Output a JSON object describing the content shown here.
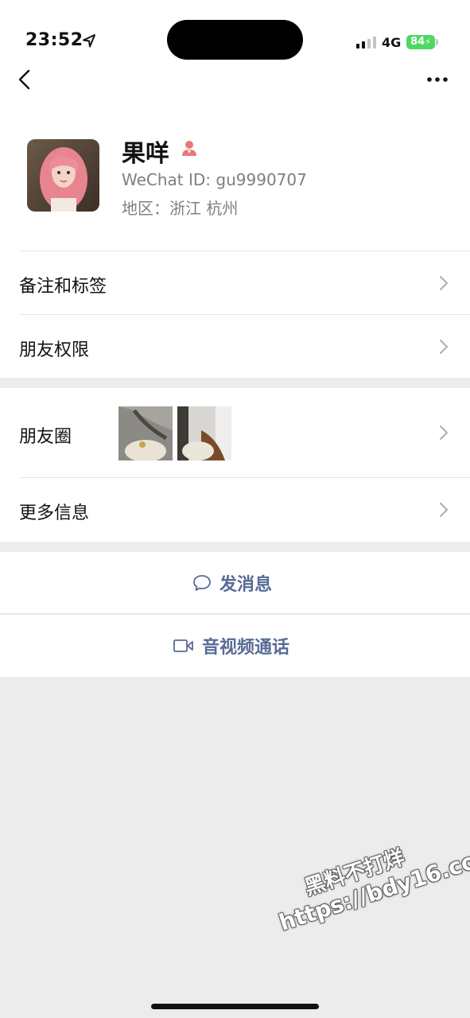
{
  "status_bar": {
    "time": "23:52",
    "network": "4G",
    "battery": "84"
  },
  "profile": {
    "name": "果咩",
    "wechat_id": "WeChat ID: gu9990707",
    "region": "地区：浙江 杭州",
    "gender_icon_color": "#e9787a"
  },
  "rows": {
    "remarks_tags": "备注和标签",
    "friend_permissions": "朋友权限",
    "moments": "朋友圈",
    "more_info": "更多信息"
  },
  "actions": {
    "send_message": "发消息",
    "video_call": "音视频通话"
  },
  "watermark": {
    "line1": "黑料不打烊",
    "line2": "https://bdy16.co"
  },
  "colors": {
    "link_blue": "#576b95",
    "battery_green": "#4cd964",
    "background_gray": "#ececec"
  }
}
